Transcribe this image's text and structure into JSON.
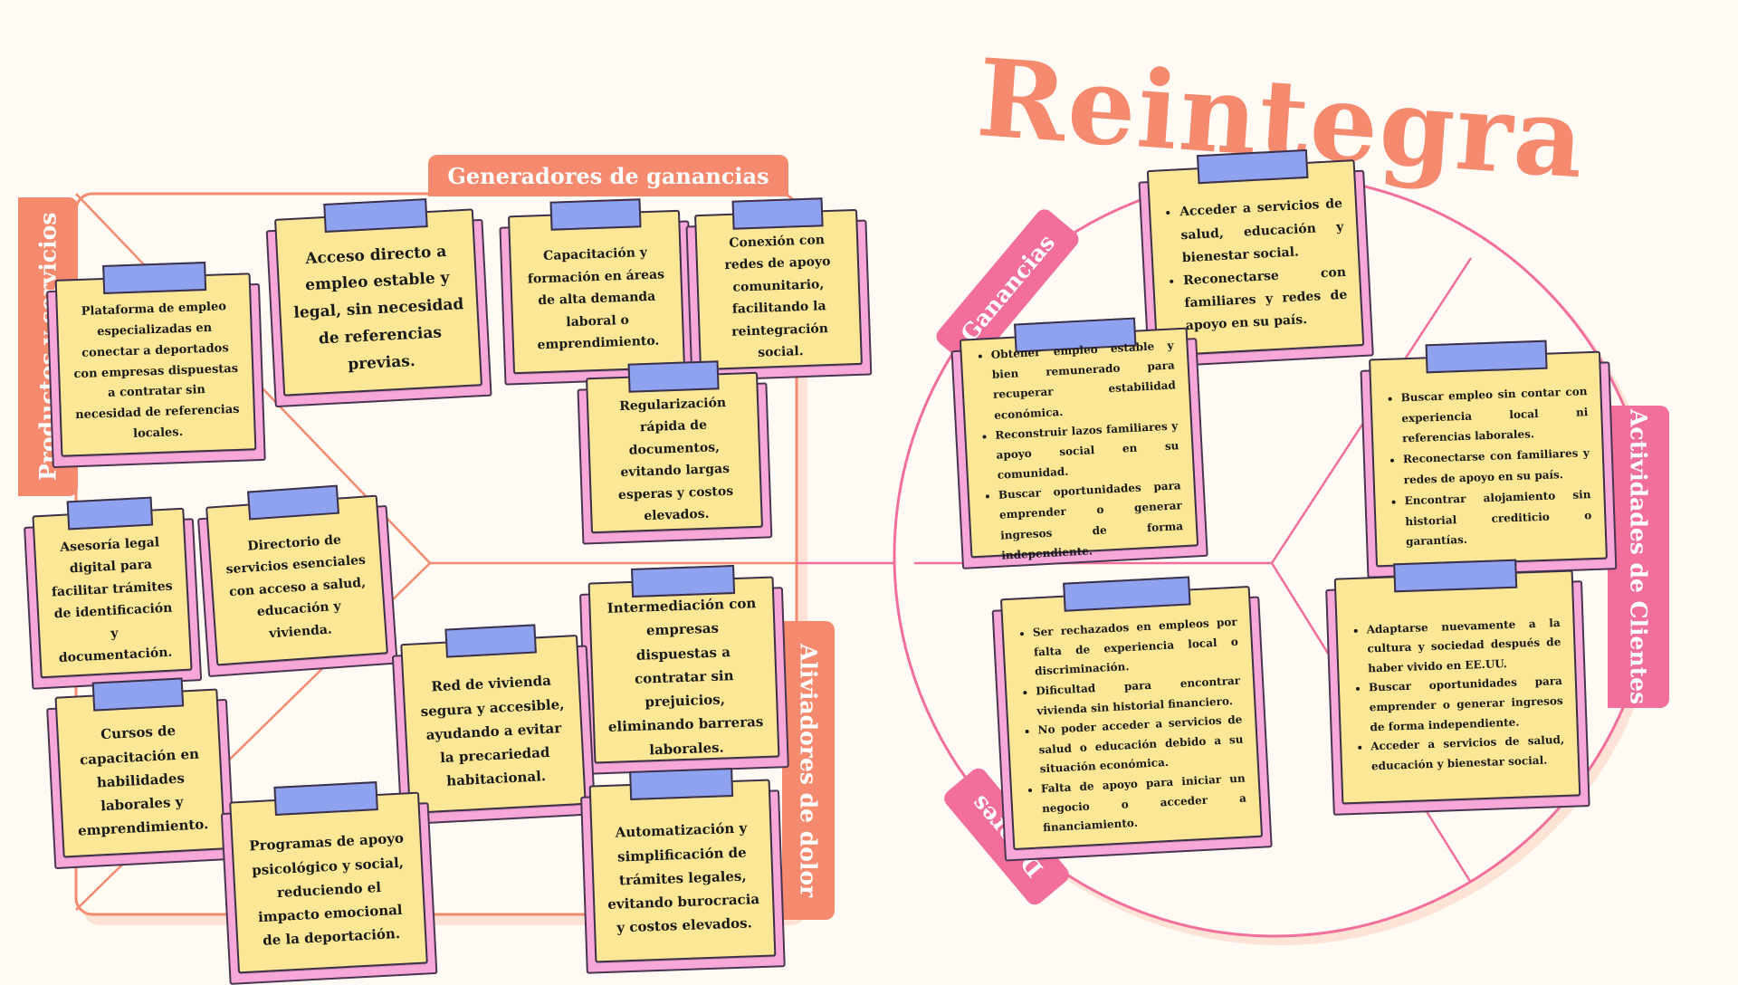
{
  "title": "Reintegra",
  "colors": {
    "coral": "#f58a6e",
    "pink": "#f26e9b",
    "note_yellow": "#fbe795",
    "note_pink": "#f7a8d8",
    "tape_blue": "#8fa2ef"
  },
  "tags": {
    "generadores": "Generadores de ganancias",
    "productos": "Productos y servicios",
    "aliviadores": "Aliviadores de dolor",
    "ganancias": "Ganancias",
    "dolores": "Dolores",
    "actividades": "Actividades de Clientes"
  },
  "value_map": {
    "productos_servicios": [
      {
        "text": "Plataforma de empleo especializadas en conectar a deportados con empresas dispuestas a contratar sin necesidad de referencias locales."
      },
      {
        "text": "Asesoría legal digital para facilitar trámites de identificación y documentación."
      },
      {
        "text": "Directorio de servicios esenciales con acceso a salud, educación y vivienda."
      },
      {
        "text": "Cursos de capacitación en habilidades laborales y emprendimiento."
      }
    ],
    "generadores_ganancias": [
      {
        "text": "Acceso directo a empleo estable y legal, sin necesidad de referencias previas."
      },
      {
        "text": "Capacitación y formación en áreas de alta demanda laboral o emprendimiento."
      },
      {
        "text": "Conexión con redes de apoyo comunitario, facilitando la reintegración social."
      },
      {
        "text": "Regularización rápida de documentos, evitando largas esperas y costos elevados."
      }
    ],
    "aliviadores_dolor": [
      {
        "text": "Intermediación con empresas dispuestas a contratar sin prejuicios, eliminando barreras laborales."
      },
      {
        "text": "Red de vivienda segura y accesible, ayudando a evitar la precariedad habitacional."
      },
      {
        "text": "Programas de apoyo psicológico y social, reduciendo el impacto emocional de la deportación."
      },
      {
        "text": "Automatización y simplificación de trámites legales, evitando burocracia y costos elevados."
      }
    ]
  },
  "customer_profile": {
    "ganancias_top": [
      "Acceder a servicios de salud, educación y bienestar social.",
      "Reconectarse con familiares y redes de apoyo en su país."
    ],
    "ganancias": [
      "Obtener empleo estable y bien remunerado para recuperar estabilidad económica.",
      "Reconstruir lazos familiares y apoyo social en su comunidad.",
      "Buscar oportunidades para emprender o generar ingresos de forma independiente."
    ],
    "dolores": [
      "Ser rechazados en empleos por falta de experiencia local o discriminación.",
      "Dificultad para encontrar vivienda sin historial financiero.",
      "No poder acceder a servicios de salud o educación debido a su situación económica.",
      "Falta de apoyo para iniciar un negocio o acceder a financiamiento."
    ],
    "actividades_1": [
      "Buscar empleo sin contar con experiencia local ni referencias laborales.",
      "Reconectarse con familiares y redes de apoyo en su país.",
      "Encontrar alojamiento sin historial crediticio o garantías."
    ],
    "actividades_2": [
      "Adaptarse nuevamente a la cultura y sociedad después de haber vivido en EE.UU.",
      "Buscar oportunidades para emprender o generar ingresos de forma independiente.",
      "Acceder a servicios de salud, educación y bienestar social."
    ]
  }
}
